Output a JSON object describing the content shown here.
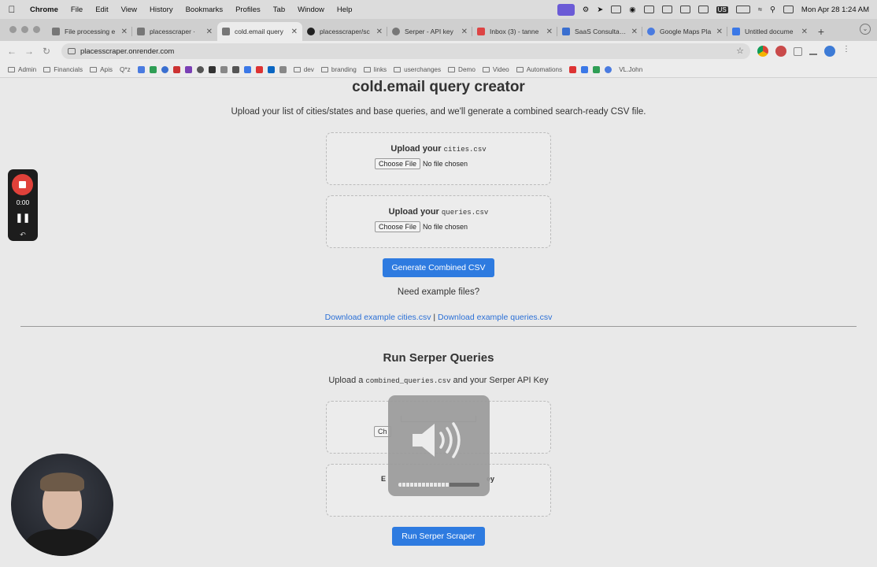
{
  "menubar": {
    "app": "Chrome",
    "items": [
      "File",
      "Edit",
      "View",
      "History",
      "Bookmarks",
      "Profiles",
      "Tab",
      "Window",
      "Help"
    ],
    "clock": "Mon Apr 28  1:24 AM",
    "input_source": "US"
  },
  "tabs": [
    {
      "label": "File processing e",
      "active": false
    },
    {
      "label": "placesscraper ·",
      "active": false
    },
    {
      "label": "cold.email query",
      "active": true
    },
    {
      "label": "placesscraper/sc",
      "active": false
    },
    {
      "label": "Serper - API key",
      "active": false
    },
    {
      "label": "Inbox (3) - tanne",
      "active": false
    },
    {
      "label": "SaaS Consultants",
      "active": false
    },
    {
      "label": "Google Maps Pla",
      "active": false
    },
    {
      "label": "Untitled docume",
      "active": false
    }
  ],
  "address": {
    "url": "placesscraper.onrender.com"
  },
  "bookmarks": [
    "Admin",
    "Financials",
    "Apis",
    "Q*z",
    "dev",
    "branding",
    "links",
    "userchanges",
    "Demo",
    "Video",
    "Automations",
    "VL.John"
  ],
  "page": {
    "title": "cold.email query creator",
    "subtitle": "Upload your list of cities/states and base queries, and we'll generate a combined search-ready CSV file.",
    "cities_upload": {
      "prefix": "Upload your ",
      "file": "cities.csv",
      "button": "Choose File",
      "status": "No file chosen"
    },
    "queries_upload": {
      "prefix": "Upload your ",
      "file": "queries.csv",
      "button": "Choose File",
      "status": "No file chosen"
    },
    "generate_button": "Generate Combined CSV",
    "need_examples": "Need example files?",
    "download_cities": "Download example cities.csv",
    "download_separator": " | ",
    "download_queries": "Download example queries.csv",
    "serper": {
      "heading": "Run Serper Queries",
      "instructions_prefix": "Upload a ",
      "instructions_file": "combined_queries.csv",
      "instructions_suffix": " and your Serper API Key",
      "partial_button": "Ch",
      "partial_label_start": "E",
      "partial_label_end": "ey",
      "run_button": "Run Serper Scraper"
    }
  },
  "recorder": {
    "time": "0:00"
  },
  "volume_hud": {
    "level": 0.63
  }
}
